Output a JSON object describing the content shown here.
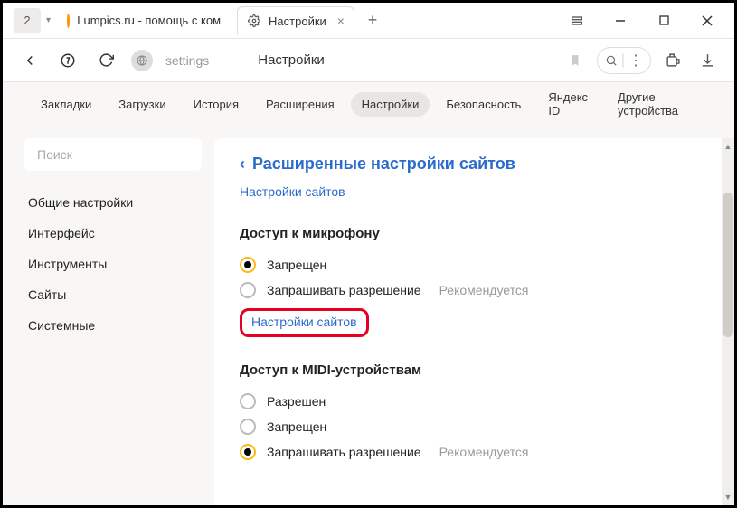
{
  "titlebar": {
    "tab_counter": "2",
    "tabs": [
      {
        "label": "Lumpics.ru - помощь с ком"
      },
      {
        "label": "Настройки"
      }
    ]
  },
  "toolbar": {
    "url": "settings",
    "title": "Настройки"
  },
  "tabsnav": [
    "Закладки",
    "Загрузки",
    "История",
    "Расширения",
    "Настройки",
    "Безопасность",
    "Яндекс ID",
    "Другие устройства"
  ],
  "sidebar": {
    "search_placeholder": "Поиск",
    "items": [
      "Общие настройки",
      "Интерфейс",
      "Инструменты",
      "Сайты",
      "Системные"
    ]
  },
  "main": {
    "crumb_title": "Расширенные настройки сайтов",
    "top_link": "Настройки сайтов",
    "section1": {
      "title": "Доступ к микрофону",
      "opt1": "Запрещен",
      "opt2": "Запрашивать разрешение",
      "rec": "Рекомендуется",
      "link": "Настройки сайтов"
    },
    "section2": {
      "title": "Доступ к MIDI-устройствам",
      "opt1": "Разрешен",
      "opt2": "Запрещен",
      "opt3": "Запрашивать разрешение",
      "rec": "Рекомендуется"
    }
  }
}
